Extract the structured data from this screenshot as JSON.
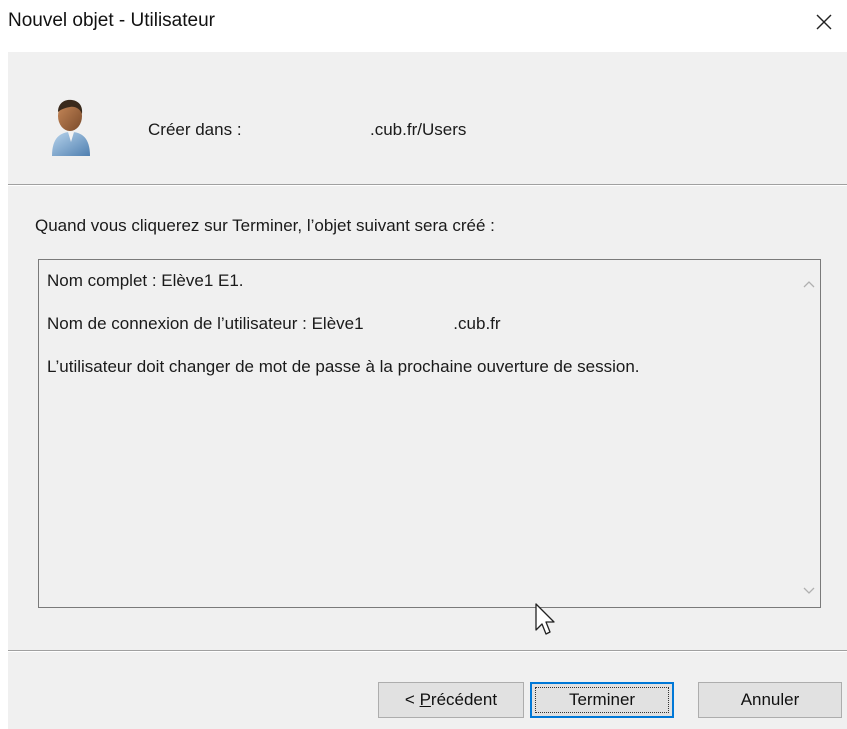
{
  "window": {
    "title": "Nouvel objet - Utilisateur",
    "close_icon": "close-icon"
  },
  "header": {
    "avatar_icon": "user-avatar-icon",
    "create_label": "Créer dans :",
    "create_value": ".cub.fr/Users"
  },
  "intro_text": "Quand vous cliquerez sur Terminer, l’objet suivant sera créé :",
  "summary": {
    "lines": [
      "Nom complet : Elève1 E1.",
      "Nom de connexion de l’utilisateur : Elève1                   .cub.fr",
      "L’utilisateur doit changer de mot de passe à la prochaine ouverture de session."
    ]
  },
  "buttons": {
    "prev_prefix": "< ",
    "prev_mnemonic": "P",
    "prev_rest": "récédent",
    "finish_label": "Terminer",
    "cancel_label": "Annuler"
  }
}
